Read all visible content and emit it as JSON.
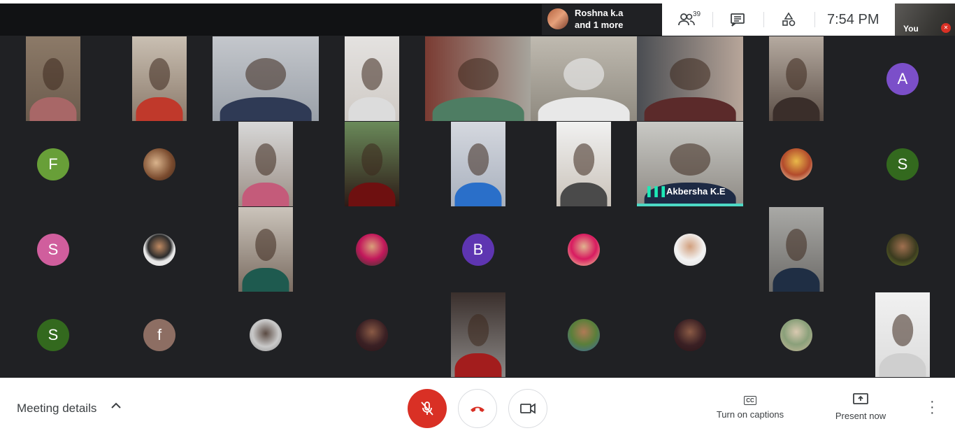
{
  "presenting": {
    "name": "Roshna k.a",
    "more": "and 1 more"
  },
  "toolbar": {
    "participants_icon": "people-icon",
    "participant_count": "39",
    "chat_icon": "chat-icon",
    "activities_icon": "shapes-icon",
    "time": "7:54 PM"
  },
  "self_tile": {
    "label": "You",
    "muted_icon": "mic-off-icon"
  },
  "active_speaker": {
    "name": "Akbersha K.E",
    "speaking_icon": "audio-bars-icon",
    "bars": "▌▌▌"
  },
  "letter_avatars": [
    {
      "letter": "A",
      "color": "#7b4fc9"
    },
    {
      "letter": "F",
      "color": "#689f38"
    },
    {
      "letter": "S",
      "color": "#33691e"
    },
    {
      "letter": "S",
      "color": "#d05e9d"
    },
    {
      "letter": "B",
      "color": "#5e35b1"
    },
    {
      "letter": "S",
      "color": "#33691e"
    },
    {
      "letter": "f",
      "color": "#8d6e63"
    }
  ],
  "bottom": {
    "meeting_details": "Meeting details",
    "chevron": "⌃",
    "mic_button_icon": "mic-off-icon",
    "leave_button_icon": "hang-up-icon",
    "camera_button_icon": "video-camera-icon",
    "captions_label": "Turn on captions",
    "captions_icon_text": "CC",
    "present_label": "Present now",
    "present_icon": "present-screen-icon",
    "more_icon": "more-vert-icon"
  }
}
